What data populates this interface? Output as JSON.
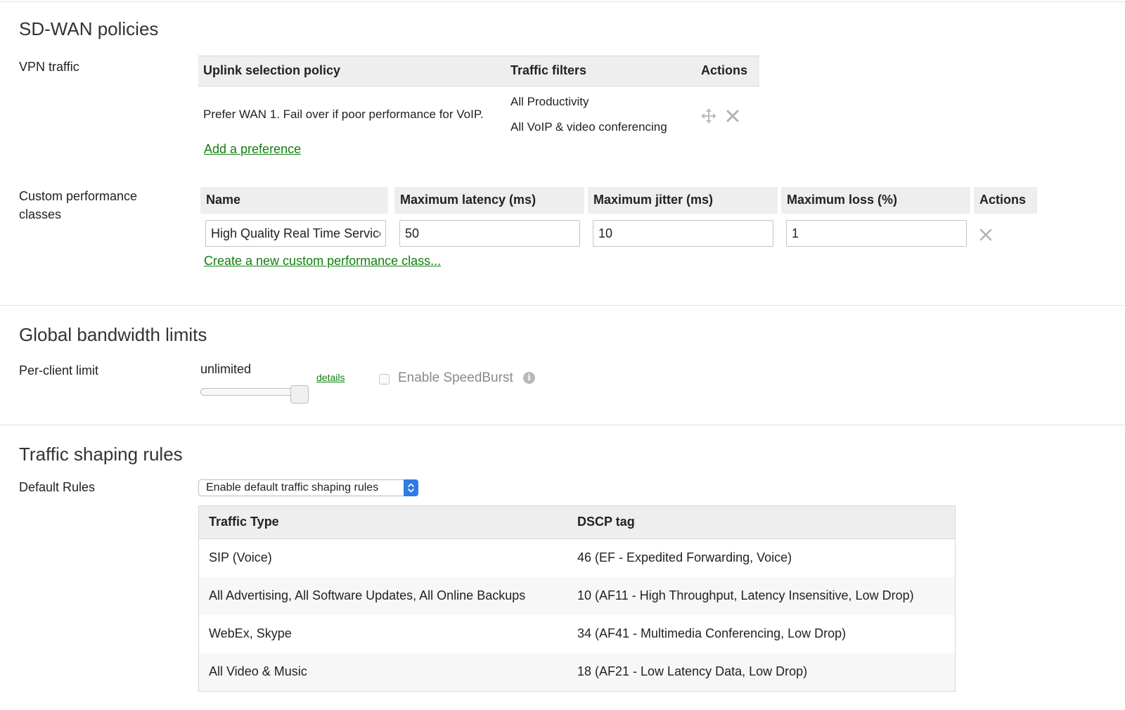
{
  "sdwan": {
    "title": "SD-WAN policies",
    "vpn_label": "VPN traffic",
    "vpn_table": {
      "headers": [
        "Uplink selection policy",
        "Traffic filters",
        "Actions"
      ],
      "row": {
        "policy": "Prefer WAN 1. Fail over if poor performance for VoIP.",
        "filters": [
          "All Productivity",
          "All VoIP & video conferencing"
        ]
      }
    },
    "add_preference": "Add a preference",
    "perf_label": "Custom performance classes",
    "perf_table": {
      "headers": [
        "Name",
        "Maximum latency (ms)",
        "Maximum jitter (ms)",
        "Maximum loss (%)",
        "Actions"
      ],
      "row": {
        "name": "High Quality Real Time Service",
        "latency": "50",
        "jitter": "10",
        "loss": "1"
      }
    },
    "create_class": "Create a new custom performance class..."
  },
  "bandwidth": {
    "title": "Global bandwidth limits",
    "per_client_label": "Per-client limit",
    "limit_value": "unlimited",
    "slider_level_percent": 100,
    "details_link": "details",
    "speedburst_label": "Enable SpeedBurst",
    "speedburst_checked": false,
    "info_icon": "info-icon"
  },
  "shaping": {
    "title": "Traffic shaping rules",
    "default_rules_label": "Default Rules",
    "default_rules_selected": "Enable default traffic shaping rules",
    "table": {
      "headers": [
        "Traffic Type",
        "DSCP tag"
      ],
      "rows": [
        {
          "type": "SIP (Voice)",
          "dscp": "46 (EF - Expedited Forwarding, Voice)"
        },
        {
          "type": "All Advertising, All Software Updates, All Online Backups",
          "dscp": "10 (AF11 - High Throughput, Latency Insensitive, Low Drop)"
        },
        {
          "type": "WebEx, Skype",
          "dscp": "34 (AF41 - Multimedia Conferencing, Low Drop)"
        },
        {
          "type": "All Video & Music",
          "dscp": "18 (AF21 - Low Latency Data, Low Drop)"
        }
      ]
    }
  },
  "colors": {
    "link": "#118011",
    "select_arrow": "#2f7ae5",
    "header_bg": "#eeeeee"
  }
}
